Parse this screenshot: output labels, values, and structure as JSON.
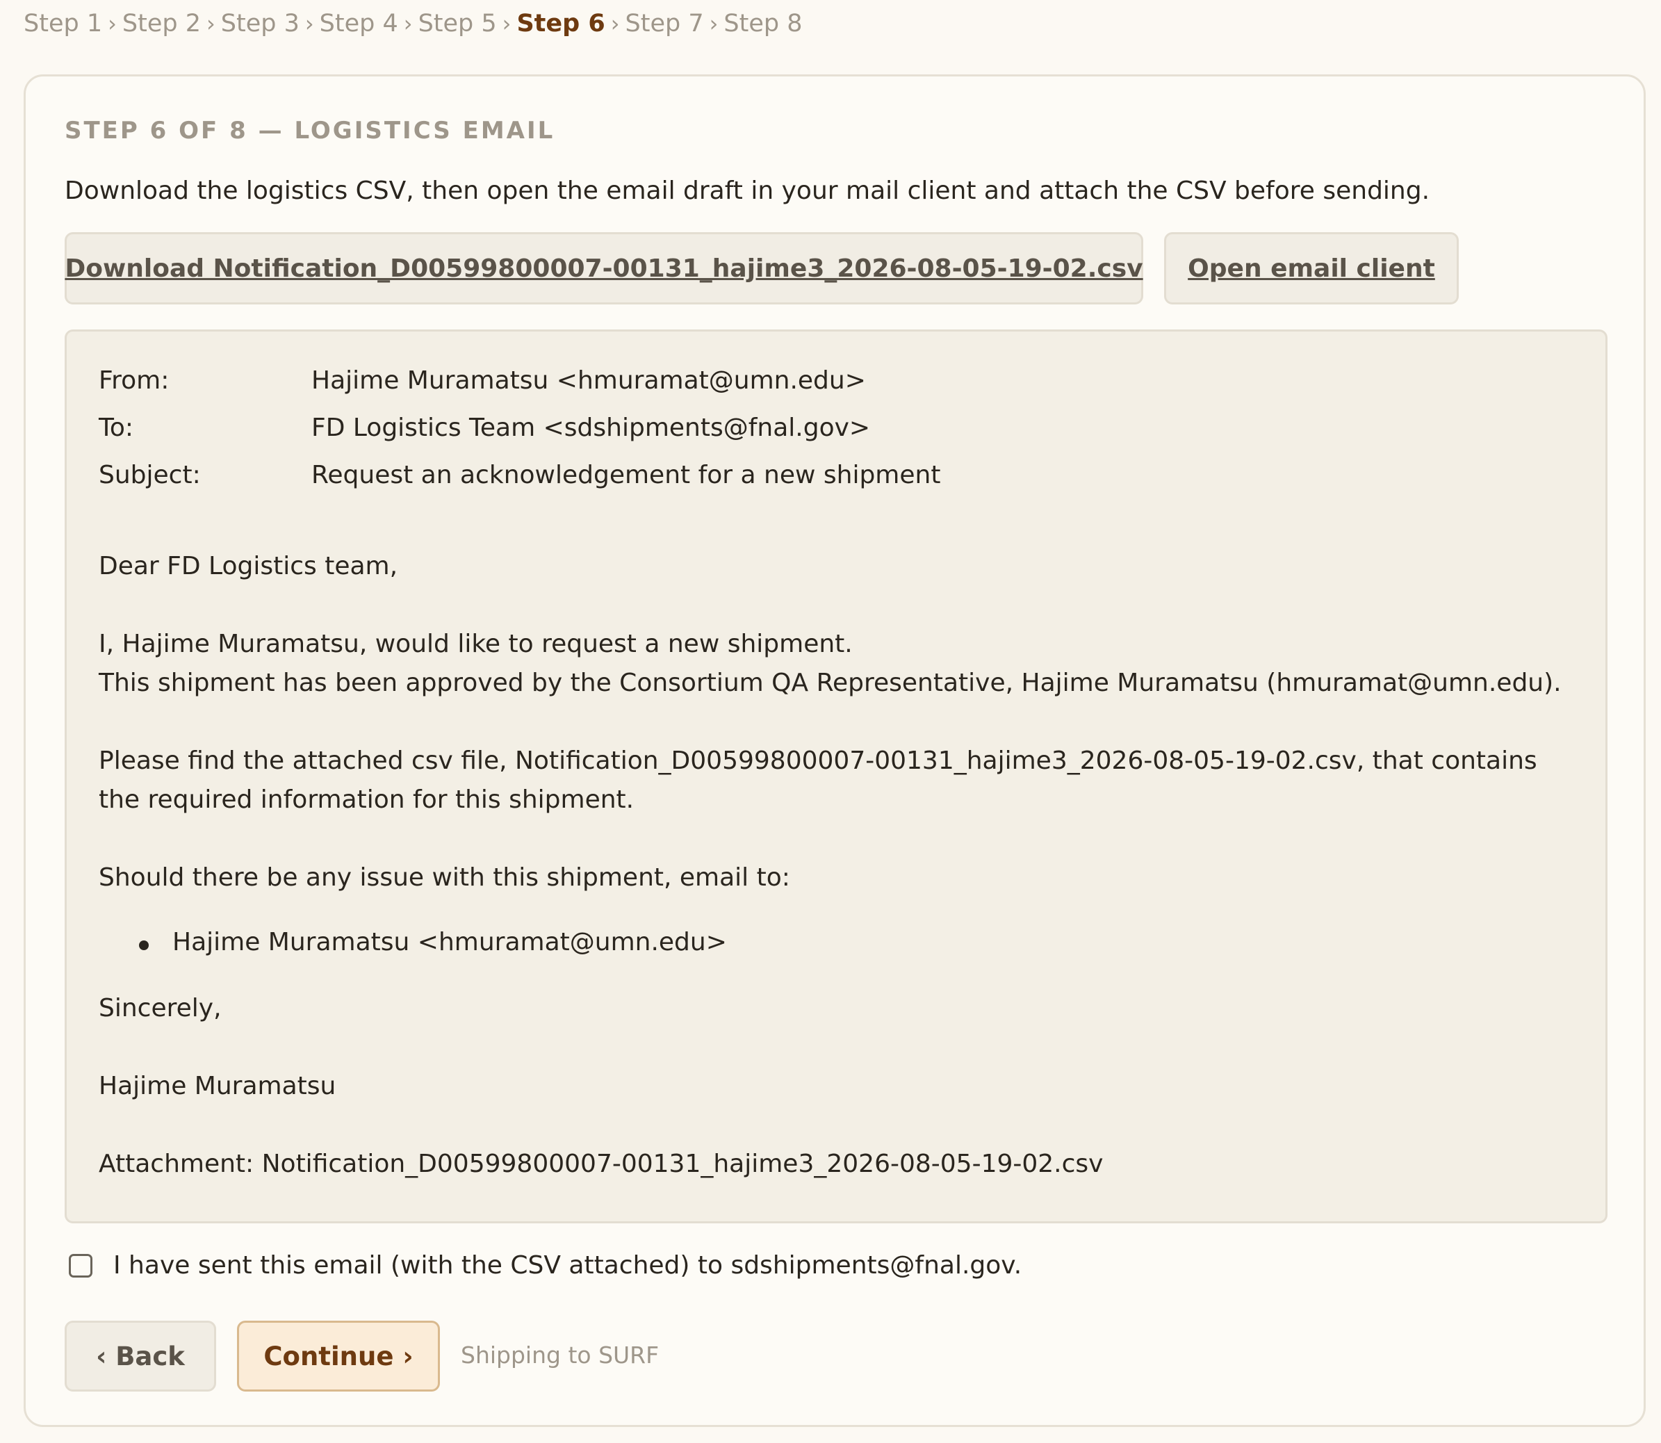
{
  "breadcrumb": {
    "separator": "›",
    "steps": [
      "Step 1",
      "Step 2",
      "Step 3",
      "Step 4",
      "Step 5",
      "Step 6",
      "Step 7",
      "Step 8"
    ],
    "current_index": 5
  },
  "card": {
    "title": "STEP 6 OF 8 — LOGISTICS EMAIL",
    "intro": "Download the logistics CSV, then open the email draft in your mail client and attach the CSV before sending."
  },
  "actions": {
    "download_label": "Download Notification_D00599800007-00131_hajime3_2026-08-05-19-02.csv",
    "open_email_label": "Open email client"
  },
  "email": {
    "from_label": "From:",
    "from_value": "Hajime Muramatsu <hmuramat@umn.edu>",
    "to_label": "To:",
    "to_value": "FD Logistics Team <sdshipments@fnal.gov>",
    "subject_label": "Subject:",
    "subject_value": "Request an acknowledgement for a new shipment",
    "greeting": "Dear FD Logistics team,",
    "para1_line1": "I, Hajime Muramatsu, would like to request a new shipment.",
    "para1_line2": "This shipment has been approved by the Consortium QA Representative, Hajime Muramatsu (hmuramat@umn.edu).",
    "para2": "Please find the attached csv file, Notification_D00599800007-00131_hajime3_2026-08-05-19-02.csv, that contains the required information for this shipment.",
    "para3": "Should there be any issue with this shipment, email to:",
    "contacts": [
      "Hajime Muramatsu <hmuramat@umn.edu>"
    ],
    "closing": "Sincerely,",
    "signature": "Hajime Muramatsu",
    "attachment": "Attachment: Notification_D00599800007-00131_hajime3_2026-08-05-19-02.csv"
  },
  "confirm": {
    "label": "I have sent this email (with the CSV attached) to sdshipments@fnal.gov.",
    "checked": false
  },
  "nav": {
    "back_label": "‹ Back",
    "continue_label": "Continue ›",
    "shipping_note": "Shipping to SURF"
  }
}
